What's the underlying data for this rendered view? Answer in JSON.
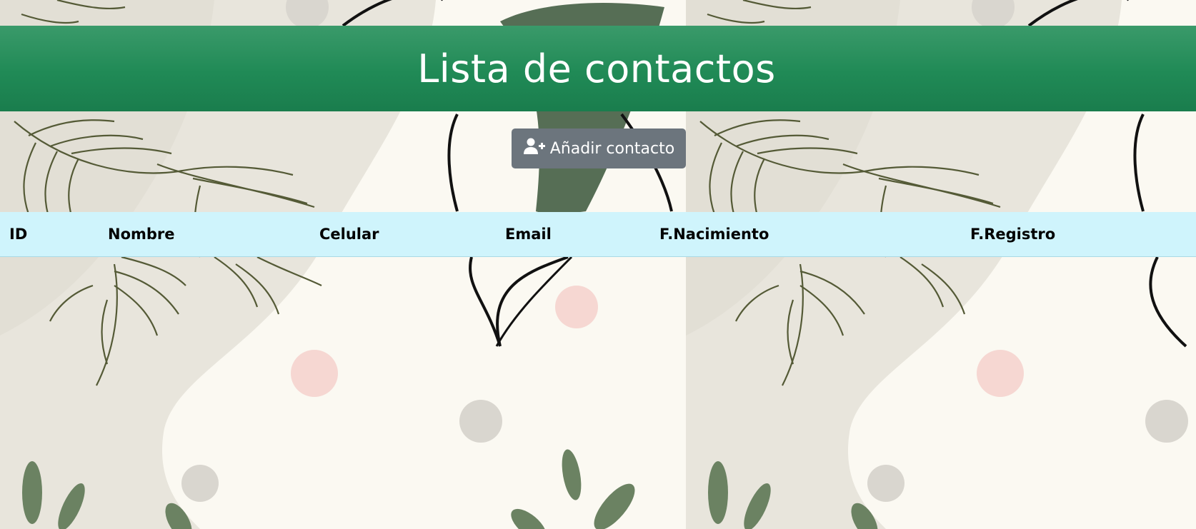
{
  "header": {
    "title": "Lista de contactos"
  },
  "actions": {
    "add_contact_label": "Añadir contacto",
    "add_contact_icon": "user-plus-icon"
  },
  "table": {
    "columns": [
      "ID",
      "Nombre",
      "Celular",
      "Email",
      "F.Nacimiento",
      "F.Registro"
    ],
    "rows": []
  },
  "colors": {
    "header_bg": "#208a56",
    "button_bg": "#6c757d",
    "table_header_bg": "#cff4fc",
    "background": "#fbf9f2"
  }
}
